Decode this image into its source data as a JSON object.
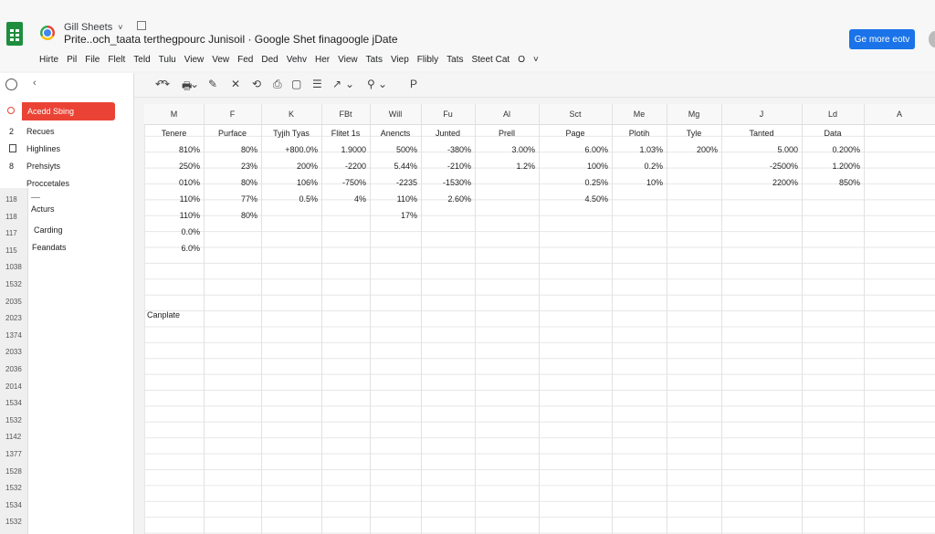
{
  "app": {
    "name": "Gill Sheets",
    "name_caret": "˅",
    "doc_title": "Prite..och_taata terthegpourc Junisoil · Google Shet finagoogle jDate",
    "share_label": "Ge more eotv"
  },
  "menu": [
    "Hirte",
    "Pil",
    "File",
    "Flelt",
    "Teld",
    "Tulu",
    "View",
    "Vew",
    "Fed",
    "Ded",
    "Vehv",
    "Her",
    "View",
    "Tats",
    "Viep",
    "Flibly",
    "Tats",
    "Steet Cat",
    "O",
    "˅"
  ],
  "toolbar": [
    "↶",
    "↷",
    "🖶",
    "⌄",
    "✎",
    "✕",
    "⟲",
    "⎙",
    "▢",
    "☰",
    "↗",
    "⌄",
    "⚲",
    "⌄",
    "P"
  ],
  "leftpanel": {
    "active": "Acedd Sbing",
    "items": [
      "Recues",
      "Highlines",
      "Prehsiyts",
      "Proccetales",
      "Acturs",
      "Carding",
      "Feandats"
    ],
    "bullets": [
      "2",
      "8"
    ],
    "row_numbers": [
      "118",
      "118",
      "117",
      "115",
      "1038",
      "1532",
      "2035",
      "2023",
      "1374",
      "2033",
      "2036",
      "2014",
      "1534",
      "1532",
      "1142",
      "1377",
      "1528",
      "1532",
      "1534",
      "1532"
    ]
  },
  "columns": [
    "M",
    "F",
    "K",
    "FBt",
    "Will",
    "Fu",
    "Al",
    "Sct",
    "Me",
    "Mg",
    "J",
    "Ld",
    "A"
  ],
  "header_row": [
    "Tenere",
    "Purface",
    "Tyjih Tyas",
    "Flitet 1s",
    "Anencts",
    "Junted",
    "Prell",
    "Page",
    "Plotih",
    "Tyle",
    "Tanted",
    "Data"
  ],
  "rows": [
    [
      "810%",
      "80%",
      "+800.0%",
      "1.9000",
      "500%",
      "-380%",
      "3.00%",
      "6.00%",
      "1.03%",
      "200%",
      "5.000",
      "0.200%"
    ],
    [
      "250%",
      "23%",
      "200%",
      "-2200",
      "5.44%",
      "-210%",
      "1.2%",
      "100%",
      "0.2%",
      "",
      "-2500%",
      "1.200%"
    ],
    [
      "010%",
      "80%",
      "106%",
      "-750%",
      "-2235",
      "-1530%",
      "",
      "0.25%",
      "10%",
      "",
      "2200%",
      "850%"
    ],
    [
      "110%",
      "77%",
      "0.5%",
      "4%",
      "110%",
      "2.60%",
      "",
      "4.50%",
      "",
      "",
      "",
      ""
    ],
    [
      "110%",
      "80%",
      "",
      "",
      "17%",
      "",
      "",
      "",
      "",
      "",
      "",
      ""
    ],
    [
      "0.0%",
      "",
      "",
      "",
      "",
      "",
      "",
      "",
      "",
      "",
      "",
      ""
    ],
    [
      "6.0%",
      "",
      "",
      "",
      "",
      "",
      "",
      "",
      "",
      "",
      "",
      ""
    ]
  ],
  "note": "Canplate"
}
